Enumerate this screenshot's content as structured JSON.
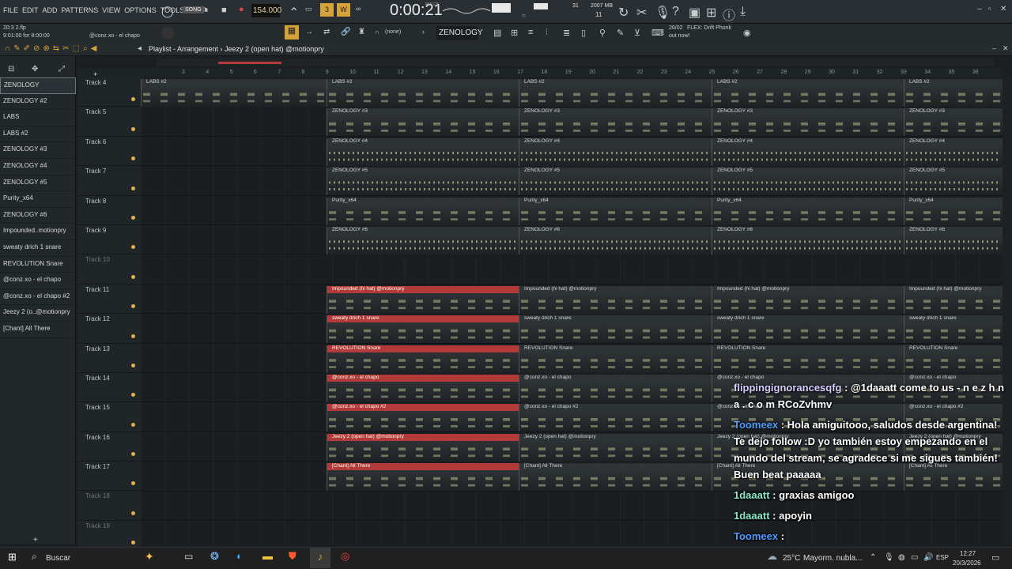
{
  "menubar": {
    "items": [
      "FILE",
      "EDIT",
      "ADD",
      "PATTERNS",
      "VIEW",
      "OPTIONS",
      "TOOLS",
      "HELP"
    ],
    "song_label": "SONG",
    "tempo": "154.000",
    "time": "0:00:21",
    "time_sub": "M:S:CS",
    "memory": "2007 MB",
    "cpu_top": "31",
    "cpu_bottom": "11"
  },
  "project": {
    "file": "20:3 2.flp",
    "position": "9:01:00 for 8:00:00",
    "channel": "@conz.xo - el chapo",
    "pattern": "ZENOLOGY",
    "snap": "(none)",
    "news_date": "26/02",
    "news_text": "FLEX: Drift Phonk",
    "news_sub": "out now!"
  },
  "playlist": {
    "title": "Playlist - Arrangement",
    "breadcrumb": "Jeezy 2 (open hat) @motionpry"
  },
  "ruler": [
    "3",
    "4",
    "5",
    "6",
    "7",
    "8",
    "9",
    "10",
    "11",
    "12",
    "13",
    "14",
    "15",
    "16",
    "17",
    "18",
    "19",
    "20",
    "21",
    "22",
    "23",
    "24",
    "25",
    "26",
    "27",
    "28",
    "29",
    "30",
    "31",
    "32",
    "33",
    "34",
    "35",
    "36"
  ],
  "picker": [
    "ZENOLOGY",
    "ZENOLOGY #2",
    "LABS",
    "LABS #2",
    "ZENOLOGY #3",
    "ZENOLOGY #4",
    "ZENOLOGY #5",
    "Purity_x64",
    "ZENOLOGY #6",
    "Impounded..motionpry",
    "sweaty drich 1 snare",
    "REVOLUTION Snare",
    "@conz.xo - el chapo",
    "@conz.xo - el chapo #2",
    "Jeezy 2 (o..@motionpry",
    "[Chant] All There"
  ],
  "tracks": [
    {
      "name": "Track 4",
      "clip": "LABS #2",
      "type": "notes",
      "full": true
    },
    {
      "name": "Track 5",
      "clip": "ZENOLOGY #3",
      "type": "notes"
    },
    {
      "name": "Track 6",
      "clip": "ZENOLOGY #4",
      "type": "dots"
    },
    {
      "name": "Track 7",
      "clip": "ZENOLOGY #5",
      "type": "dots"
    },
    {
      "name": "Track 8",
      "clip": "Purity_x64",
      "type": "notes"
    },
    {
      "name": "Track 9",
      "clip": "ZENOLOGY #6",
      "type": "dots"
    },
    {
      "name": "Track 10",
      "clip": "",
      "type": "none"
    },
    {
      "name": "Track 11",
      "clip": "Impounded (hi hat) @motionpry",
      "type": "red"
    },
    {
      "name": "Track 12",
      "clip": "sweaty drich 1 snare",
      "type": "red"
    },
    {
      "name": "Track 13",
      "clip": "REVOLUTION Snare",
      "type": "red"
    },
    {
      "name": "Track 14",
      "clip": "@conz.xo - el chapo",
      "type": "red"
    },
    {
      "name": "Track 15",
      "clip": "@conz.xo - el chapo #2",
      "type": "red"
    },
    {
      "name": "Track 16",
      "clip": "Jeezy 2 (open hat) @motionpry",
      "type": "red"
    },
    {
      "name": "Track 17",
      "clip": "[Chant] All There",
      "type": "red"
    },
    {
      "name": "Track 18",
      "clip": "",
      "type": "none"
    },
    {
      "name": "Track 19",
      "clip": "",
      "type": "none"
    }
  ],
  "chat": [
    {
      "user": "flippingignorancesqfg",
      "text": "@1daaatt come to us - n e z h n a . c o m RCoZvhmv",
      "color": "#d7cbff"
    },
    {
      "user": "Toomeex",
      "text": "Hola amiguitooo, saludos desde argentina! Te dejo follow :D yo también estoy empezando en el mundo del stream, se agradece si me sigues también! Buen beat paaaaa",
      "color": "#4e9cff"
    },
    {
      "user": "1daaatt",
      "text": "graxias amigoo",
      "color": "#8fe6c8"
    },
    {
      "user": "1daaatt",
      "text": "apoyin",
      "color": "#8fe6c8"
    },
    {
      "user": "Toomeex",
      "text": "",
      "color": "#4e9cff"
    }
  ],
  "taskbar": {
    "search": "Buscar",
    "weather": "25°C",
    "weather_desc": "Mayorm. nubla...",
    "lang": "ESP",
    "clock": "12:27",
    "date": "20/3/2026"
  }
}
